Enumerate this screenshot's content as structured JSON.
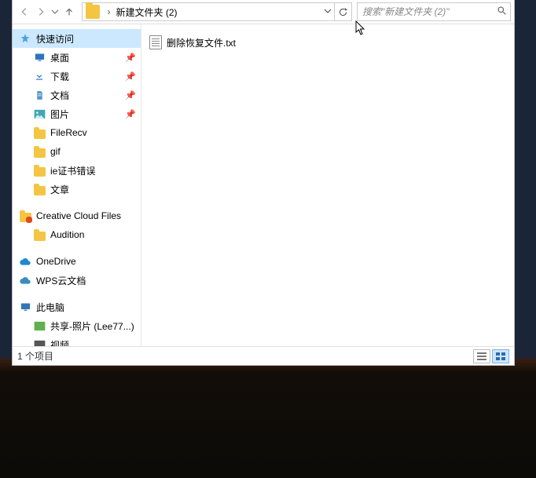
{
  "toolbar": {
    "breadcrumb_root": "",
    "breadcrumb_current": "新建文件夹 (2)"
  },
  "search": {
    "placeholder": "搜索\"新建文件夹 (2)\""
  },
  "nav": {
    "quick_access": "快速访问",
    "desktop": "桌面",
    "downloads": "下载",
    "documents": "文档",
    "pictures": "图片",
    "filerecv": "FileRecv",
    "gif": "gif",
    "iecert": "ie证书错误",
    "articles": "文章",
    "ccf": "Creative Cloud Files",
    "audition": "Audition",
    "onedrive": "OneDrive",
    "wps": "WPS云文档",
    "thispc": "此电脑",
    "shared": "共享-照片 (Lee77...)",
    "video": "视频"
  },
  "files": {
    "item0": "删除恢复文件.txt"
  },
  "status": {
    "count": "1 个项目"
  }
}
